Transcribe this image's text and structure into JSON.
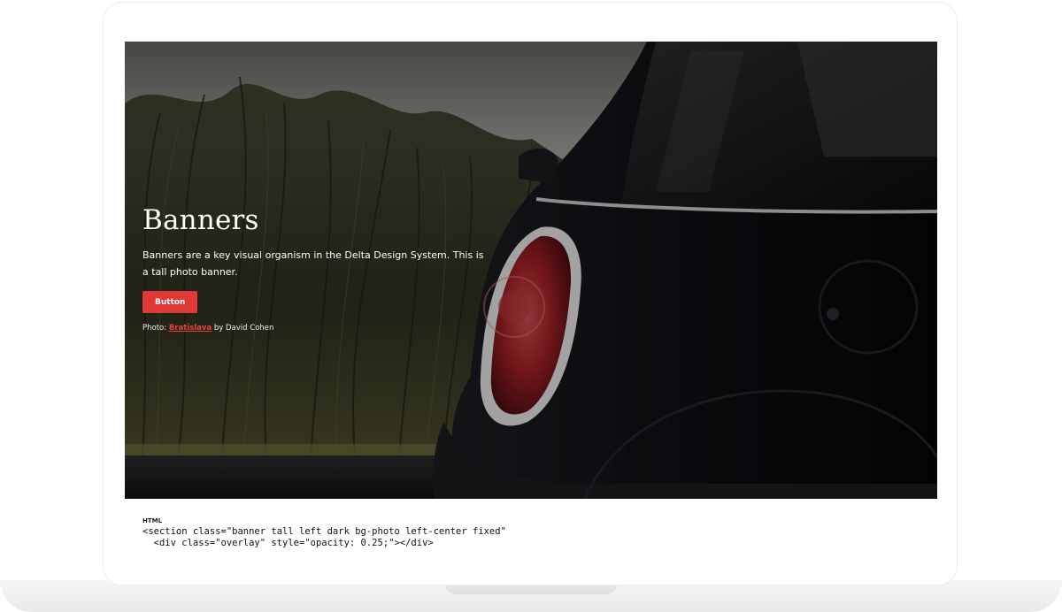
{
  "banner": {
    "title": "Banners",
    "description": "Banners are a key visual organism in the Delta Design System. This is a tall photo banner.",
    "button_label": "Button",
    "credit": {
      "prefix": "Photo: ",
      "link_text": "Bratislava",
      "suffix": " by David Cohen"
    },
    "accent_color": "#e03a36"
  },
  "code": {
    "label": "HTML",
    "lines": [
      "<section class=\"banner tall left dark bg-photo left-center fixed\"",
      "  <div class=\"overlay\" style=\"opacity: 0.25;\"></div>"
    ]
  }
}
